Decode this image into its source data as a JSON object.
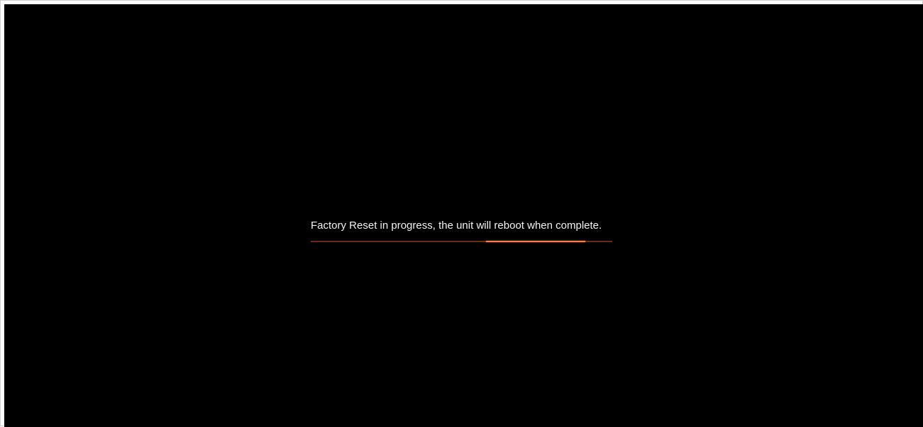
{
  "status": {
    "message": "Factory Reset in progress, the unit will reboot when complete."
  },
  "progress": {
    "indeterminate": true,
    "active_segment_start_fraction": 0.58,
    "active_segment_end_fraction": 0.91
  },
  "colors": {
    "background": "#000000",
    "text": "#f2f2f2",
    "progress_track": "#6f2a1f",
    "progress_fill": "#ff7a52"
  }
}
